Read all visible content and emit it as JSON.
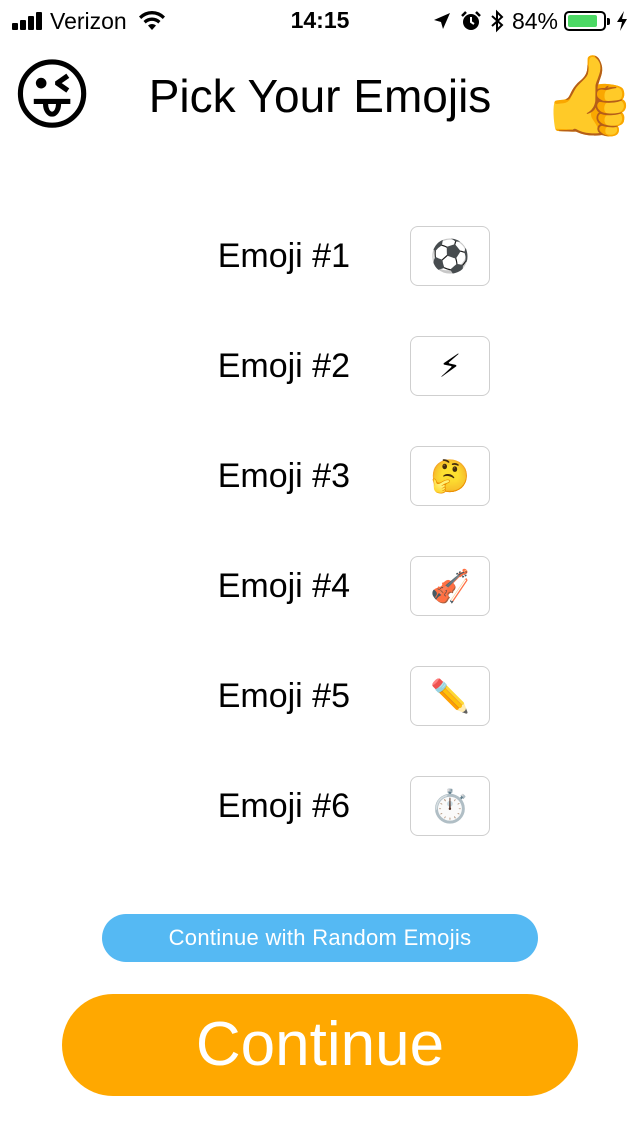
{
  "status_bar": {
    "carrier": "Verizon",
    "time": "14:15",
    "battery_percent": "84%",
    "battery_level": 0.84,
    "icons": [
      "signal-icon",
      "wifi-icon",
      "location-icon",
      "alarm-icon",
      "bluetooth-icon",
      "battery-icon",
      "charging-icon"
    ]
  },
  "header": {
    "title": "Pick Your Emojis",
    "left_emoji": "😜",
    "right_emoji": "👍"
  },
  "emoji_slots": [
    {
      "label": "Emoji #1",
      "emoji": "⚽"
    },
    {
      "label": "Emoji #2",
      "emoji": "⚡"
    },
    {
      "label": "Emoji #3",
      "emoji": "🤔"
    },
    {
      "label": "Emoji #4",
      "emoji": "🎻"
    },
    {
      "label": "Emoji #5",
      "emoji": "✏️"
    },
    {
      "label": "Emoji #6",
      "emoji": "⏱️"
    }
  ],
  "actions": {
    "random_label": "Continue with Random Emojis",
    "continue_label": "Continue"
  },
  "colors": {
    "random_button": "#55b9f3",
    "continue_button": "#ffa800",
    "battery": "#4cd964"
  }
}
